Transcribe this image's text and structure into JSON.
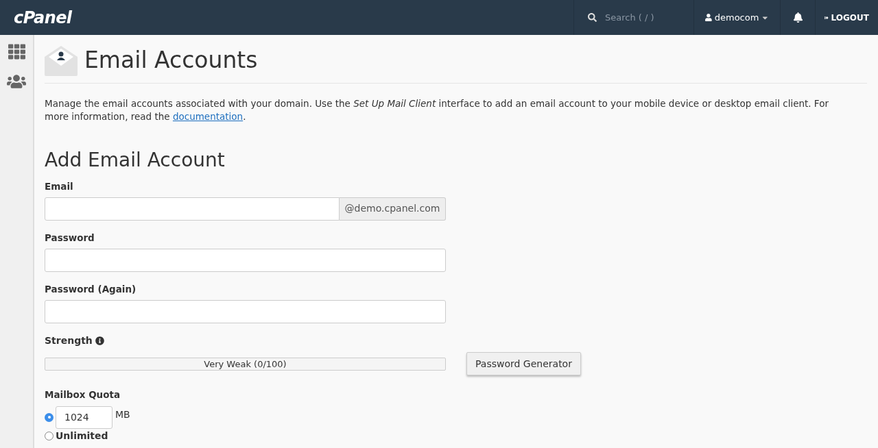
{
  "header": {
    "logo": "cPanel",
    "search": {
      "placeholder": "Search ( / )"
    },
    "user": "democom",
    "logout": "LOGOUT"
  },
  "page": {
    "title": "Email Accounts",
    "intro": {
      "before": "Manage the email accounts associated with your domain. Use the *Set Up Mail Client* interface to add an email account to your mobile device or desktop email client. For more information, read the ",
      "link": "documentation",
      "after": "."
    }
  },
  "form": {
    "title": "Add Email Account",
    "email": {
      "label": "Email",
      "domain": "@demo.cpanel.com"
    },
    "password": {
      "label": "Password"
    },
    "password_again": {
      "label": "Password (Again)"
    },
    "strength": {
      "label": "Strength",
      "level": 0,
      "reading": "Very Weak (0/100)",
      "generator": "Password Generator"
    },
    "quota": {
      "label": "Mailbox Quota",
      "options": [
        {
          "kind": "amount",
          "selected": true,
          "value": "1024",
          "unit": "MB"
        },
        {
          "kind": "unlimited",
          "selected": false,
          "label": "Unlimited"
        }
      ]
    }
  }
}
